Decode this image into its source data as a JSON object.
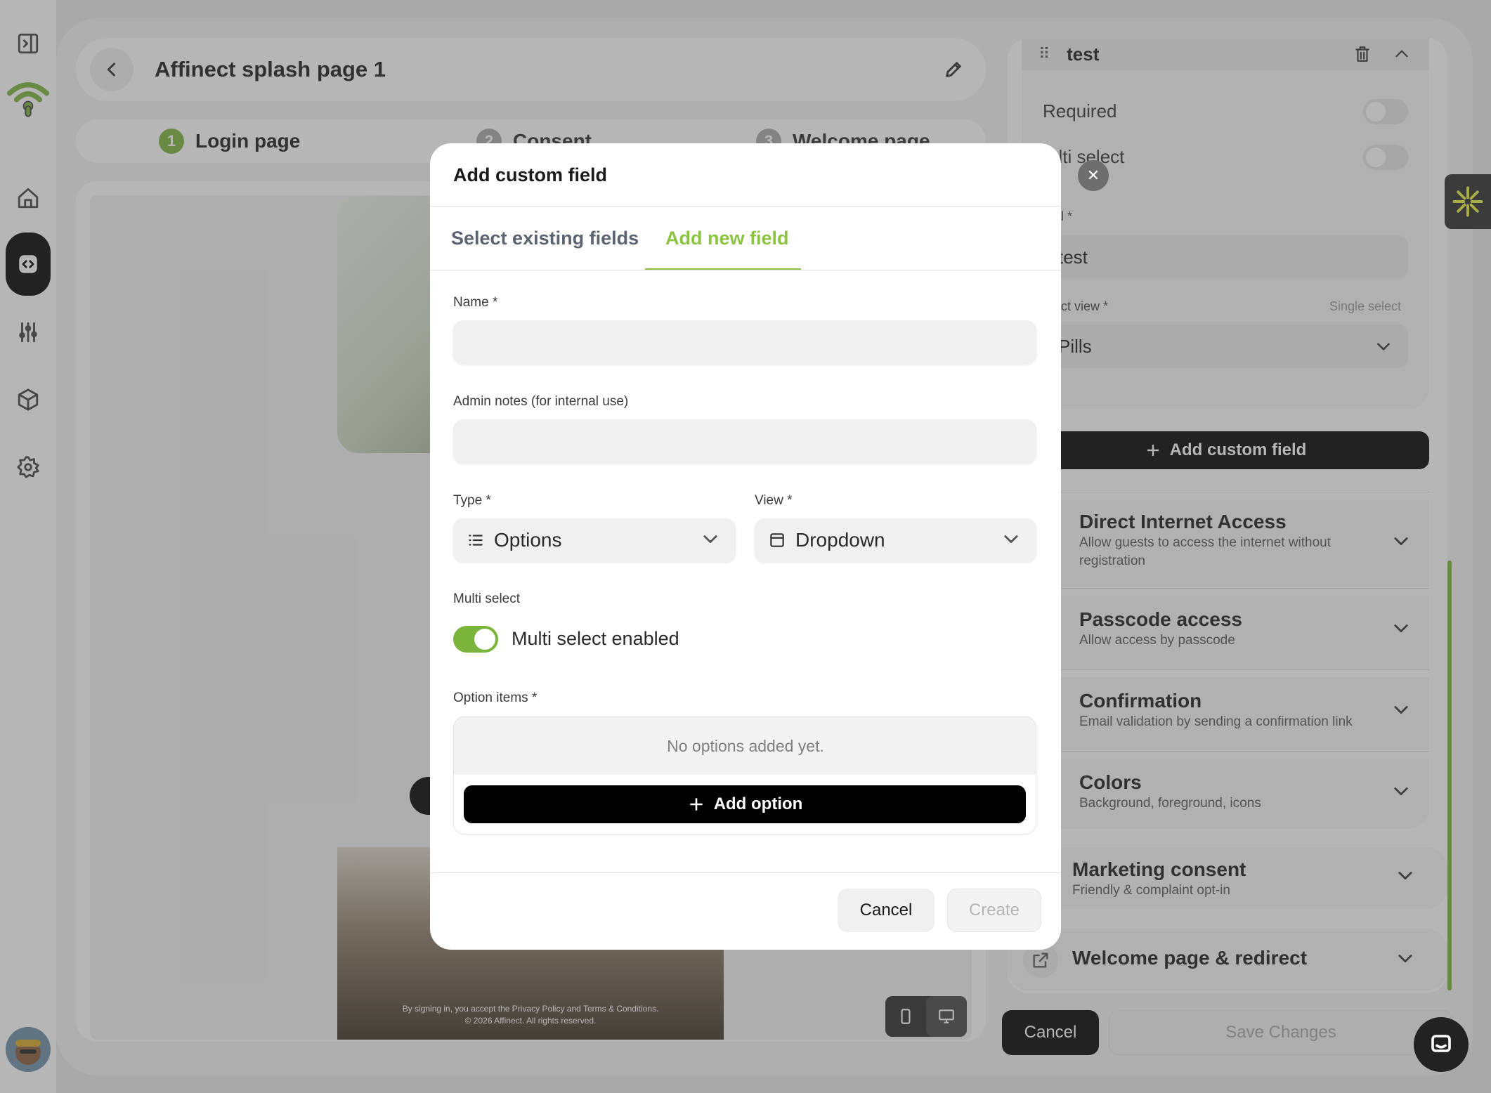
{
  "app": {
    "page_title": "Affinect splash page 1"
  },
  "steps": [
    {
      "num": "1",
      "label": "Login page"
    },
    {
      "num": "2",
      "label": "Consent"
    },
    {
      "num": "3",
      "label": "Welcome page"
    }
  ],
  "preview": {
    "footer_line1": "By signing in, you accept the Privacy Policy and Terms & Conditions.",
    "footer_line2": "© 2026 Affinect. All rights reserved."
  },
  "field_card": {
    "title": "test",
    "required_label": "Required",
    "multi_select_label": "ulti select",
    "label_caption": "el *",
    "label_value": "test",
    "select_view_caption": "ect view *",
    "select_view_hint": "Single select",
    "select_view_value": "Pills"
  },
  "add_custom_field_label": "Add custom field",
  "sections": [
    {
      "title": "Direct Internet Access",
      "sub": "Allow guests to access the internet without registration"
    },
    {
      "title": "Passcode access",
      "sub": "Allow access by passcode"
    },
    {
      "title": "Confirmation",
      "sub": "Email validation by sending a confirmation link"
    },
    {
      "title": "Colors",
      "sub": "Background, foreground, icons"
    },
    {
      "title": "Marketing consent",
      "sub": "Friendly & complaint opt-in"
    },
    {
      "title": "Welcome page & redirect",
      "sub": ""
    }
  ],
  "footer": {
    "cancel": "Cancel",
    "save": "Save Changes"
  },
  "modal": {
    "title": "Add custom field",
    "tabs": [
      "Select existing fields",
      "Add new field"
    ],
    "active_tab": "Add new field",
    "name_label": "Name *",
    "name_value": "",
    "notes_label": "Admin notes (for internal use)",
    "notes_value": "",
    "type_label": "Type *",
    "type_value": "Options",
    "view_label": "View *",
    "view_value": "Dropdown",
    "multi_select_label": "Multi select",
    "multi_select_toggle_label": "Multi select enabled",
    "multi_select_enabled": true,
    "option_items_label": "Option items *",
    "options_empty": "No options added yet.",
    "add_option": "Add option",
    "cancel": "Cancel",
    "create": "Create"
  },
  "colors": {
    "accent": "#7bb43a",
    "tab_active": "#8cc442",
    "primary_button": "#000000"
  },
  "icons": [
    "sidebar-toggle-icon",
    "wifi-logo-icon",
    "home-icon",
    "code-icon",
    "sliders-icon",
    "box-icon",
    "gear-icon",
    "chevron-left-icon",
    "pencil-icon",
    "trash-icon",
    "chevron-up-icon",
    "chevron-down-icon",
    "plus-icon",
    "list-icon",
    "window-icon",
    "external-link-icon",
    "chat-icon",
    "close-icon"
  ]
}
